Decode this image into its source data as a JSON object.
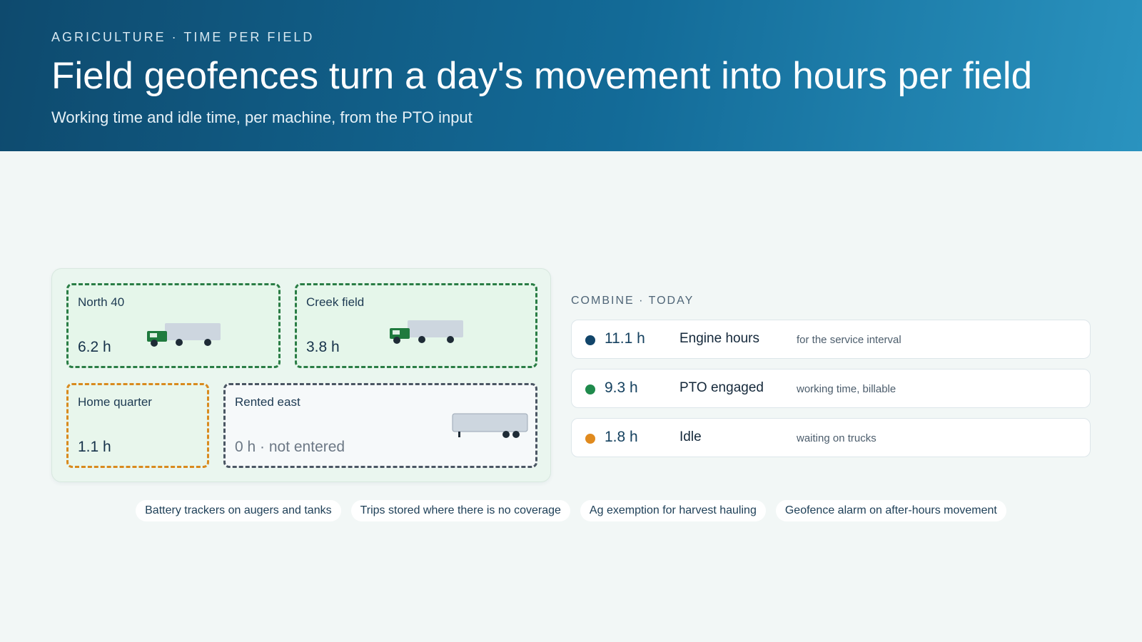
{
  "header": {
    "eyebrow": "AGRICULTURE · TIME PER FIELD",
    "title": "Field geofences turn a day's movement into hours per field",
    "subtitle": "Working time and idle time, per machine, from the PTO input"
  },
  "fields": [
    {
      "name": "North 40",
      "hours": "6.2 h",
      "status": "active"
    },
    {
      "name": "Creek field",
      "hours": "3.8 h",
      "status": "active"
    },
    {
      "name": "Home quarter",
      "hours": "1.1 h",
      "status": "partial"
    },
    {
      "name": "Rented east",
      "hours": "0 h · not entered",
      "status": "not-entered"
    }
  ],
  "summary": {
    "heading": "COMBINE · TODAY",
    "metrics": [
      {
        "value": "11.1 h",
        "label": "Engine hours",
        "note": "for the service interval",
        "color": "#12456a"
      },
      {
        "value": "9.3 h",
        "label": "PTO engaged",
        "note": "working time, billable",
        "color": "#1f8a4c"
      },
      {
        "value": "1.8 h",
        "label": "Idle",
        "note": "waiting on trucks",
        "color": "#e08a1e"
      }
    ]
  },
  "chips": [
    "Battery trackers on augers and tanks",
    "Trips stored where there is no coverage",
    "Ag exemption for harvest hauling",
    "Geofence alarm on after-hours movement"
  ],
  "colors": {
    "field_active": "#2a7d45",
    "field_partial": "#d98a1e",
    "field_inactive": "#4a5663",
    "tractor_cab": "#1f7a3e",
    "trailer_body": "#cdd6df"
  }
}
